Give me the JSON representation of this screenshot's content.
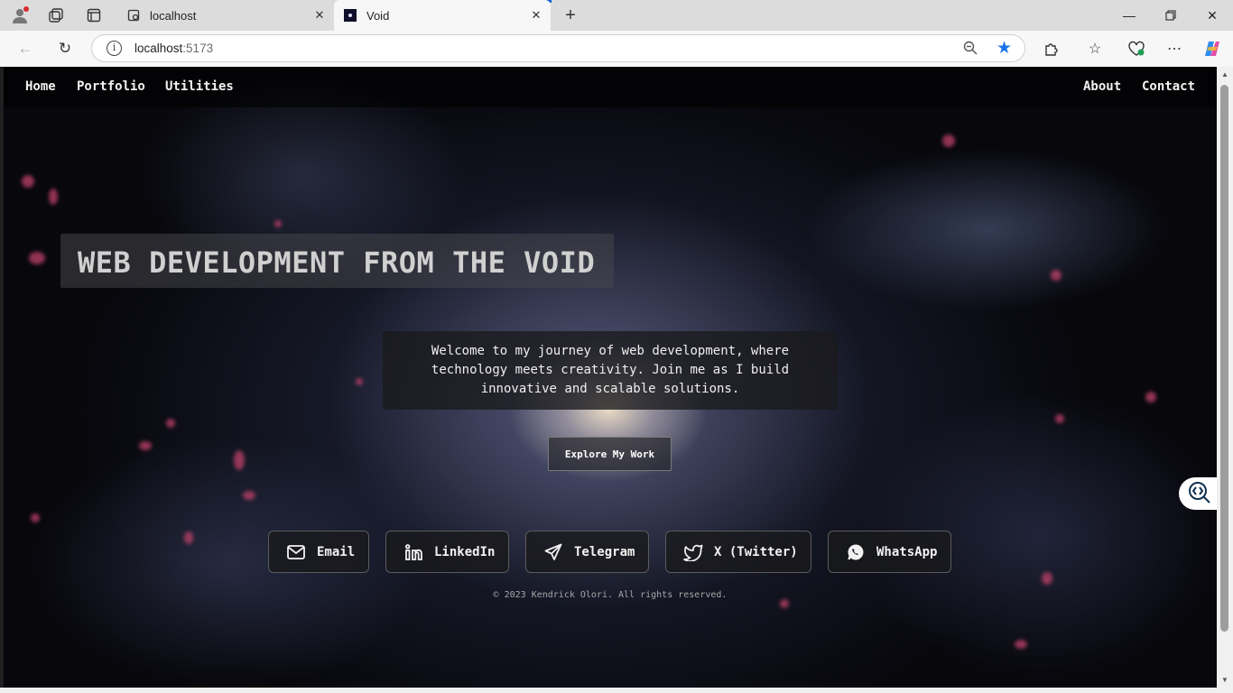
{
  "browser": {
    "tabs": [
      {
        "title": "localhost",
        "favicon": "page-icon"
      },
      {
        "title": "Void",
        "favicon": "void-favicon"
      }
    ],
    "address": {
      "host": "localhost",
      "port": ":5173"
    },
    "icons": [
      "profile-icon",
      "collections-icon",
      "tab-actions-icon",
      "back-icon",
      "refresh-icon",
      "zoom-out-icon",
      "favorite-star-icon",
      "extensions-icon",
      "favorites-icon",
      "browser-essentials-icon",
      "more-icon",
      "copilot-icon",
      "minimize-icon",
      "restore-icon",
      "close-icon"
    ]
  },
  "nav": {
    "left": [
      "Home",
      "Portfolio",
      "Utilities"
    ],
    "right": [
      "About",
      "Contact"
    ]
  },
  "hero": {
    "title": "WEB DEVELOPMENT FROM THE VOID",
    "welcome": "Welcome to my journey of web development, where technology meets creativity. Join me as I build innovative and scalable solutions.",
    "cta": "Explore My Work"
  },
  "social": [
    {
      "label": "Email",
      "icon": "mail-icon"
    },
    {
      "label": "LinkedIn",
      "icon": "linkedin-icon"
    },
    {
      "label": "Telegram",
      "icon": "telegram-icon"
    },
    {
      "label": "X (Twitter)",
      "icon": "twitter-icon"
    },
    {
      "label": "WhatsApp",
      "icon": "whatsapp-icon"
    }
  ],
  "footer": {
    "copyright": "© 2023 Kendrick Olori. All rights reserved."
  },
  "colors": {
    "accent_blue": "#1a73e8",
    "background": "#07070c",
    "nebula_pink": "#c0426a"
  }
}
